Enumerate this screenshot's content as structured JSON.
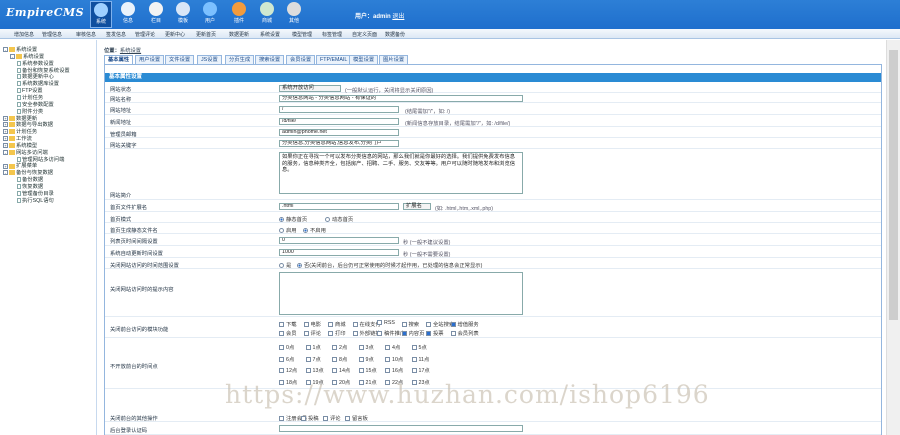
{
  "app": {
    "logo": "EmpireCMS",
    "logo_tail": ""
  },
  "nav": [
    {
      "label": "系统",
      "icon": "system-globe-icon",
      "color": "#9fd0ff",
      "active": true
    },
    {
      "label": "信息",
      "icon": "info-notepad-icon",
      "color": "#e9f2fb"
    },
    {
      "label": "栏目",
      "icon": "column-folder-icon",
      "color": "#f3f3f3"
    },
    {
      "label": "模板",
      "icon": "template-icon",
      "color": "#d9e6f7"
    },
    {
      "label": "用户",
      "icon": "user-icon",
      "color": "#7cc0ff"
    },
    {
      "label": "插件",
      "icon": "plugin-tools-icon",
      "color": "#f39b3c"
    },
    {
      "label": "商城",
      "icon": "shop-icon",
      "color": "#cfe8d0"
    },
    {
      "label": "其他",
      "icon": "other-gear-icon",
      "color": "#dddddd"
    }
  ],
  "user": {
    "prefix": "用户：",
    "name": "admin",
    "logout": "退出"
  },
  "menu": [
    "增加信息",
    "管理信息",
    "审核信息",
    "签发信息",
    "管理评论",
    "更新中心",
    "更新首页",
    "数据更新",
    "系统设置",
    "模型管理",
    "标签管理",
    "自定义页面",
    "数据备份"
  ],
  "sidebar": [
    {
      "text": "系统设置",
      "level": 0,
      "type": "folder",
      "box": "-"
    },
    {
      "text": "系统设置",
      "level": 1,
      "type": "folder",
      "box": "-"
    },
    {
      "text": "系统参数设置",
      "level": 2,
      "type": "page"
    },
    {
      "text": "备份和恢复系统设置",
      "level": 2,
      "type": "page"
    },
    {
      "text": "数据更新中心",
      "level": 2,
      "type": "page"
    },
    {
      "text": "系统数据库设置",
      "level": 2,
      "type": "page"
    },
    {
      "text": "FTP设置",
      "level": 2,
      "type": "page"
    },
    {
      "text": "计划任务",
      "level": 2,
      "type": "page"
    },
    {
      "text": "安全参数配置",
      "level": 2,
      "type": "page"
    },
    {
      "text": "附件分类",
      "level": 2,
      "type": "page"
    },
    {
      "text": "数据更新",
      "level": 0,
      "type": "folder",
      "box": "+"
    },
    {
      "text": "数据与导出数据",
      "level": 0,
      "type": "folder",
      "box": "+"
    },
    {
      "text": "计划任务",
      "level": 0,
      "type": "folder",
      "box": "+"
    },
    {
      "text": "工作流",
      "level": 0,
      "type": "folder",
      "box": "+"
    },
    {
      "text": "系统模型",
      "level": 0,
      "type": "folder",
      "box": "+"
    },
    {
      "text": "网站多访问端",
      "level": 0,
      "type": "folder",
      "box": "-"
    },
    {
      "text": "管理网站多访问端",
      "level": 2,
      "type": "page"
    },
    {
      "text": "扩展菜单",
      "level": 0,
      "type": "folder",
      "box": "+"
    },
    {
      "text": "备份与恢复数据",
      "level": 0,
      "type": "folder",
      "box": "-"
    },
    {
      "text": "备份数据",
      "level": 2,
      "type": "page"
    },
    {
      "text": "恢复数据",
      "level": 2,
      "type": "page"
    },
    {
      "text": "管理备份目录",
      "level": 2,
      "type": "page"
    },
    {
      "text": "执行SQL语句",
      "level": 2,
      "type": "page"
    }
  ],
  "crumb": {
    "prefix": "位置：",
    "link": "系统设置"
  },
  "tabs": [
    "基本属性",
    "用户设置",
    "文件设置",
    "JS设置",
    "分页生成",
    "搜索设置",
    "会员设置",
    "FTP/EMAIL",
    "模型设置",
    "图片设置"
  ],
  "section": "基本属性设置",
  "form": {
    "site_status": {
      "label": "网站状态",
      "value": "系统开放访问",
      "hint": "(一般默认运行，关闭将显示关闭原因)"
    },
    "site_name": {
      "label": "网站名称",
      "value": "分类信息网站 - 分类信息网站 - 有保证的"
    },
    "site_url": {
      "label": "网站地址",
      "value": "/",
      "hint": "(结尾需加\"/\"，如: /)"
    },
    "news_url": {
      "label": "新闻地址",
      "value": "/d/file/",
      "hint": "(新闻信息存放目录，结尾需加\"/\"，如: /d/file/)"
    },
    "admin_email": {
      "label": "管理员邮箱",
      "value": "admin@phome.net"
    },
    "keywords": {
      "label": "网站关键字",
      "value": "分类信息,分类信息网站,信息发布,分类门户"
    },
    "description": {
      "label": "网站简介",
      "value": "如果你正在寻找一个可以发布分类信息的网站，那么我们就是你最好的选择。我们提供免费发布信息的服务，信息种类齐全，包括房产、招聘、二手、服务、交友等等。用户可以随时随地发布和浏览信息。"
    },
    "ext": {
      "label": "首页文件扩展名",
      "value": ".html",
      "select": "扩展名",
      "hint": "(如: .html,.htm,.xml,.php)"
    },
    "home_mode": {
      "label": "首页模式",
      "options": [
        "静态首页",
        "动态首页"
      ],
      "selected": 0
    },
    "home_gen": {
      "label": "首页生成静态文件名",
      "options": [
        "启用",
        "不启用"
      ],
      "selected": 1
    },
    "interval": {
      "label": "列表页时间间隔设置",
      "value": "0",
      "hint": "秒 (一般不建议设置)"
    },
    "refresh": {
      "label": "系统自动更新时间设置",
      "value": "1000",
      "hint": "秒 (一般不需要设置)"
    },
    "close_site": {
      "label": "关闭网站访问的时间范围设置",
      "options": [
        "是",
        "否(关闭前台，后台仍可正常使用的时候才起作用，已处理的信息会正常显示)"
      ],
      "selected": 1
    },
    "close_reason": {
      "label": "关闭网站访问时的提示内容"
    },
    "close_modules": {
      "label": "关闭前台访问的模块功能",
      "items": [
        {
          "t": "下载",
          "c": false
        },
        {
          "t": "电影",
          "c": false
        },
        {
          "t": "商城",
          "c": false
        },
        {
          "t": "在线支付",
          "c": false
        },
        {
          "t": "RSS",
          "c": false
        },
        {
          "t": "搜索",
          "c": false
        },
        {
          "t": "全站搜索",
          "c": false
        },
        {
          "t": "增值服务",
          "c": true
        },
        {
          "t": "会员",
          "c": false
        },
        {
          "t": "评论",
          "c": false
        },
        {
          "t": "打印",
          "c": false
        },
        {
          "t": "外部链接",
          "c": false
        },
        {
          "t": "稿件推广",
          "c": false
        },
        {
          "t": "内容页",
          "c": true
        },
        {
          "t": "投票",
          "c": true
        },
        {
          "t": "会员列表",
          "c": false
        }
      ]
    },
    "close_hours": {
      "label": "不开放前台的时间点",
      "items": [
        "0点",
        "1点",
        "2点",
        "3点",
        "4点",
        "5点",
        "6点",
        "7点",
        "8点",
        "9点",
        "10点",
        "11点",
        "12点",
        "13点",
        "14点",
        "15点",
        "16点",
        "17点",
        "18点",
        "19点",
        "20点",
        "21点",
        "22点",
        "23点"
      ]
    },
    "other_ops": {
      "label": "关闭前台的其他操作",
      "items": [
        {
          "t": "注册会员",
          "c": false
        },
        {
          "t": "投稿",
          "c": false
        },
        {
          "t": "评论",
          "c": false
        },
        {
          "t": "留言板",
          "c": false
        }
      ]
    },
    "extra": {
      "label": "后台登录认证码"
    }
  },
  "watermark": "https://www.huzhan.com/ishop6196"
}
